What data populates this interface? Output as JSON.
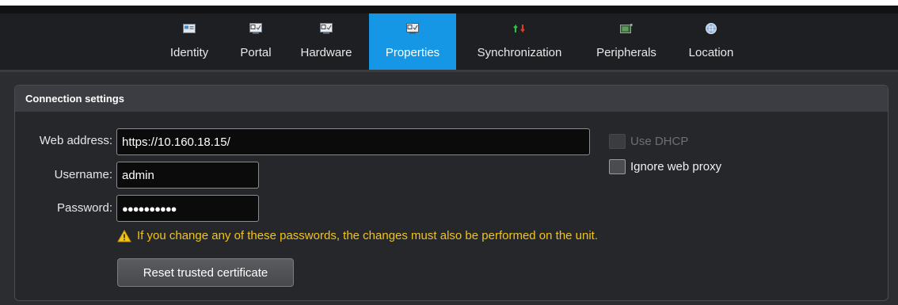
{
  "tabs": [
    {
      "label": "Identity",
      "icon": "identity-icon"
    },
    {
      "label": "Portal",
      "icon": "portal-icon"
    },
    {
      "label": "Hardware",
      "icon": "hardware-icon"
    },
    {
      "label": "Properties",
      "icon": "properties-icon",
      "active": true
    },
    {
      "label": "Synchronization",
      "icon": "sync-icon"
    },
    {
      "label": "Peripherals",
      "icon": "peripherals-icon"
    },
    {
      "label": "Location",
      "icon": "location-icon"
    }
  ],
  "panel": {
    "title": "Connection settings",
    "web_address_label": "Web address:",
    "web_address_value": "https://10.160.18.15/",
    "username_label": "Username:",
    "username_value": "admin",
    "password_label": "Password:",
    "password_value": "●●●●●●●●●●",
    "use_dhcp_label": "Use DHCP",
    "ignore_proxy_label": "Ignore web proxy",
    "warning_text": "If you change any of these passwords, the changes must also be performed on the unit.",
    "reset_button_label": "Reset trusted certificate"
  },
  "colors": {
    "accent": "#1597e5",
    "warning": "#f2c318"
  }
}
